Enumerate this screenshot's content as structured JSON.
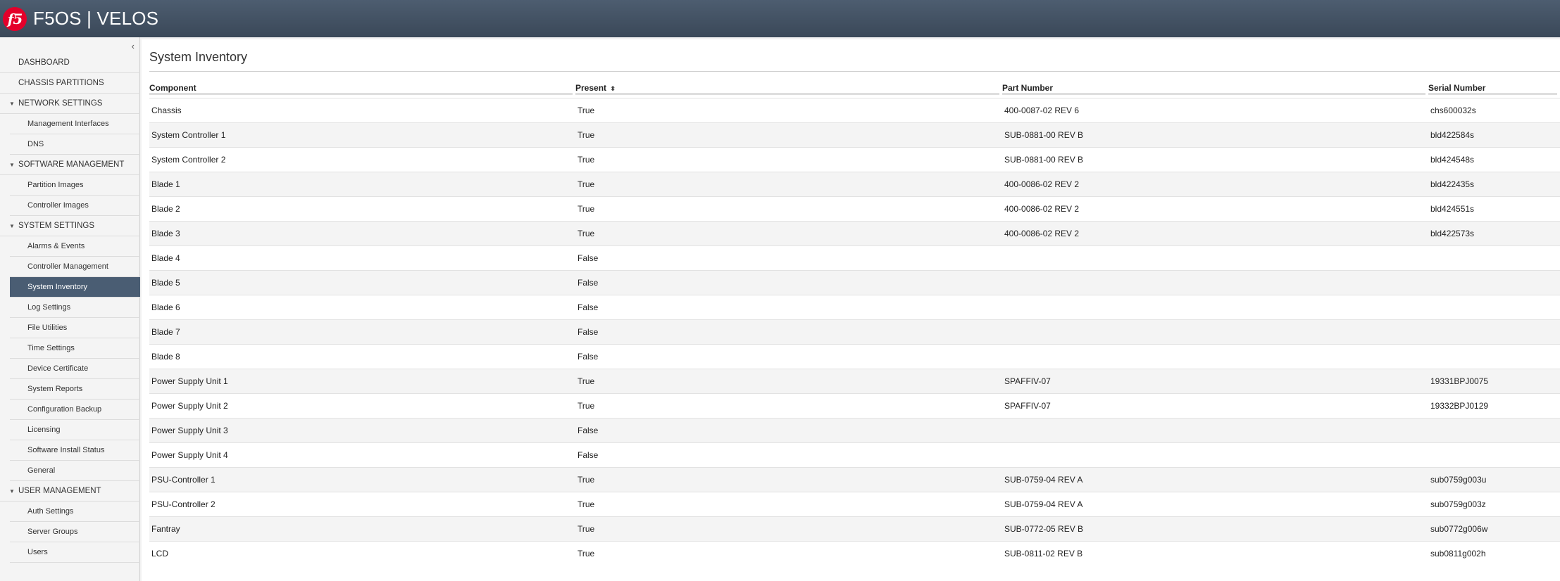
{
  "header": {
    "logo_text": "f5",
    "title": "F5OS | VELOS"
  },
  "sidebar": {
    "collapse_glyph": "‹",
    "items": [
      {
        "label": "DASHBOARD",
        "type": "top"
      },
      {
        "label": "CHASSIS PARTITIONS",
        "type": "top"
      },
      {
        "label": "NETWORK SETTINGS",
        "type": "section"
      },
      {
        "label": "Management Interfaces",
        "type": "sub"
      },
      {
        "label": "DNS",
        "type": "sub"
      },
      {
        "label": "SOFTWARE MANAGEMENT",
        "type": "section"
      },
      {
        "label": "Partition Images",
        "type": "sub"
      },
      {
        "label": "Controller Images",
        "type": "sub"
      },
      {
        "label": "SYSTEM SETTINGS",
        "type": "section"
      },
      {
        "label": "Alarms & Events",
        "type": "sub"
      },
      {
        "label": "Controller Management",
        "type": "sub"
      },
      {
        "label": "System Inventory",
        "type": "sub",
        "active": true
      },
      {
        "label": "Log Settings",
        "type": "sub"
      },
      {
        "label": "File Utilities",
        "type": "sub"
      },
      {
        "label": "Time Settings",
        "type": "sub"
      },
      {
        "label": "Device Certificate",
        "type": "sub"
      },
      {
        "label": "System Reports",
        "type": "sub"
      },
      {
        "label": "Configuration Backup",
        "type": "sub"
      },
      {
        "label": "Licensing",
        "type": "sub"
      },
      {
        "label": "Software Install Status",
        "type": "sub"
      },
      {
        "label": "General",
        "type": "sub"
      },
      {
        "label": "USER MANAGEMENT",
        "type": "section"
      },
      {
        "label": "Auth Settings",
        "type": "sub"
      },
      {
        "label": "Server Groups",
        "type": "sub"
      },
      {
        "label": "Users",
        "type": "sub"
      }
    ]
  },
  "main": {
    "title": "System Inventory",
    "columns": [
      "Component",
      "Present",
      "Part Number",
      "Serial Number"
    ],
    "sort_icon": "⬍",
    "rows": [
      [
        "Chassis",
        "True",
        "400-0087-02 REV 6",
        "chs600032s"
      ],
      [
        "System Controller 1",
        "True",
        "SUB-0881-00 REV B",
        "bld422584s"
      ],
      [
        "System Controller 2",
        "True",
        "SUB-0881-00 REV B",
        "bld424548s"
      ],
      [
        "Blade 1",
        "True",
        "400-0086-02 REV 2",
        "bld422435s"
      ],
      [
        "Blade 2",
        "True",
        "400-0086-02 REV 2",
        "bld424551s"
      ],
      [
        "Blade 3",
        "True",
        "400-0086-02 REV 2",
        "bld422573s"
      ],
      [
        "Blade 4",
        "False",
        "",
        ""
      ],
      [
        "Blade 5",
        "False",
        "",
        ""
      ],
      [
        "Blade 6",
        "False",
        "",
        ""
      ],
      [
        "Blade 7",
        "False",
        "",
        ""
      ],
      [
        "Blade 8",
        "False",
        "",
        ""
      ],
      [
        "Power Supply Unit 1",
        "True",
        "SPAFFIV-07",
        "19331BPJ0075"
      ],
      [
        "Power Supply Unit 2",
        "True",
        "SPAFFIV-07",
        "19332BPJ0129"
      ],
      [
        "Power Supply Unit 3",
        "False",
        "",
        ""
      ],
      [
        "Power Supply Unit 4",
        "False",
        "",
        ""
      ],
      [
        "PSU-Controller 1",
        "True",
        "SUB-0759-04 REV A",
        "sub0759g003u"
      ],
      [
        "PSU-Controller 2",
        "True",
        "SUB-0759-04 REV A",
        "sub0759g003z"
      ],
      [
        "Fantray",
        "True",
        "SUB-0772-05 REV B",
        "sub0772g006w"
      ],
      [
        "LCD",
        "True",
        "SUB-0811-02 REV B",
        "sub0811g002h"
      ]
    ]
  }
}
